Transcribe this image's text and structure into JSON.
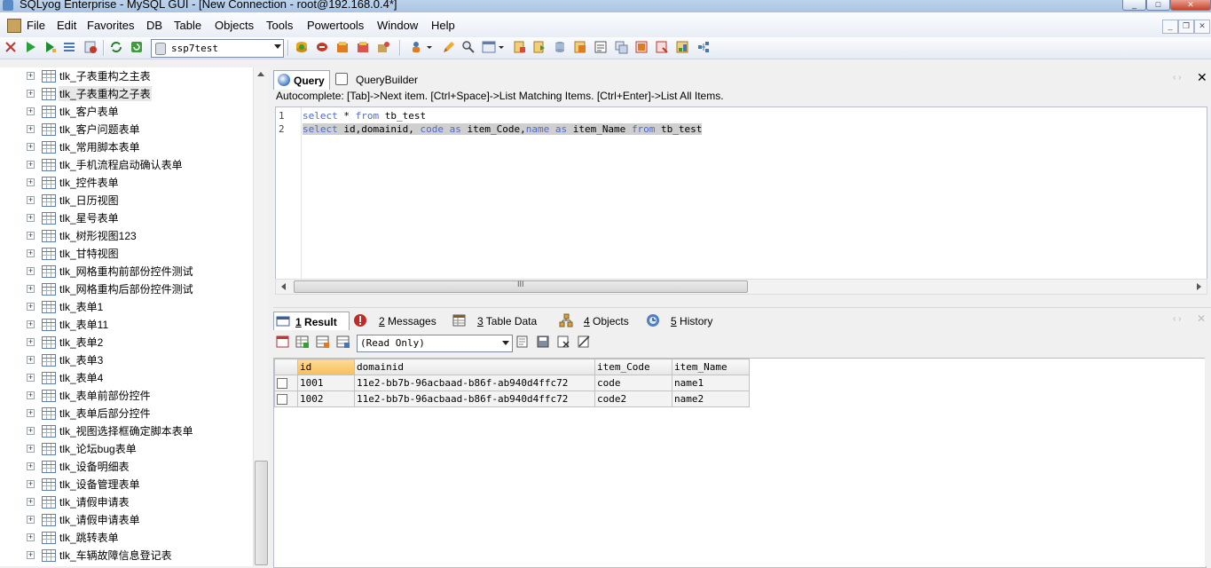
{
  "window": {
    "title": "SQLyog Enterprise - MySQL GUI - [New Connection - root@192.168.0.4*]",
    "controls": {
      "minimize": "_",
      "maximize": "□",
      "close": "✕"
    }
  },
  "menubar": {
    "items": [
      "File",
      "Edit",
      "Favorites",
      "DB",
      "Table",
      "Objects",
      "Tools",
      "Powertools",
      "Window",
      "Help"
    ],
    "mdi_controls": {
      "minimize": "_",
      "restore": "❐",
      "close": "✕"
    }
  },
  "toolbar": {
    "database_selected": "ssp7test"
  },
  "tree": {
    "items": [
      "tlk_子表重构之主表",
      "tlk_子表重构之子表",
      "tlk_客户表单",
      "tlk_客户问题表单",
      "tlk_常用脚本表单",
      "tlk_手机流程启动确认表单",
      "tlk_控件表单",
      "tlk_日历视图",
      "tlk_星号表单",
      "tlk_树形视图123",
      "tlk_甘特视图",
      "tlk_网格重构前部份控件测试",
      "tlk_网格重构后部份控件测试",
      "tlk_表单1",
      "tlk_表单11",
      "tlk_表单2",
      "tlk_表单3",
      "tlk_表单4",
      "tlk_表单前部份控件",
      "tlk_表单后部分控件",
      "tlk_视图选择框确定脚本表单",
      "tlk_论坛bug表单",
      "tlk_设备明细表",
      "tlk_设备管理表单",
      "tlk_请假申请表",
      "tlk_请假申请表单",
      "tlk_跳转表单",
      "tlk_车辆故障信息登记表"
    ],
    "expander": "+"
  },
  "query_tabs": [
    {
      "label": "Query",
      "active": true
    },
    {
      "label": "QueryBuilder",
      "active": false
    }
  ],
  "autocomplete_hint": "Autocomplete: [Tab]->Next item. [Ctrl+Space]->List Matching Items. [Ctrl+Enter]->List All Items.",
  "editor": {
    "line_numbers": [
      "1",
      "2"
    ],
    "line1": {
      "kw1": "select",
      "t1": " * ",
      "kw2": "from",
      "t2": " tb_test"
    },
    "line2": {
      "kw1": "select",
      "t1": " id,domainid, ",
      "kw2": "code",
      "t2": " ",
      "kw3": "as",
      "t3": " item_Code,",
      "kw4": "name",
      "t4": " ",
      "kw5": "as",
      "t5": " item_Name ",
      "kw6": "from",
      "t6": " tb_test"
    },
    "hscroll_grip": "III"
  },
  "result_tabs": [
    {
      "num": "1",
      "label": " Result",
      "active": true
    },
    {
      "num": "2",
      "label": " Messages",
      "active": false
    },
    {
      "num": "3",
      "label": " Table Data",
      "active": false
    },
    {
      "num": "4",
      "label": " Objects",
      "active": false
    },
    {
      "num": "5",
      "label": " History",
      "active": false
    }
  ],
  "result_mode": "(Read Only)",
  "grid": {
    "columns": [
      "id",
      "domainid",
      "item_Code",
      "item_Name"
    ],
    "rows": [
      [
        "1001",
        "11e2-bb7b-96acbaad-b86f-ab940d4ffc72",
        "code",
        "name1"
      ],
      [
        "1002",
        "11e2-bb7b-96acbaad-b86f-ab940d4ffc72",
        "code2",
        "name2"
      ]
    ]
  },
  "colors": {
    "keyword": "#4e69d6",
    "sorted_header": "#f7be56",
    "selection": "#cfcfcf"
  }
}
